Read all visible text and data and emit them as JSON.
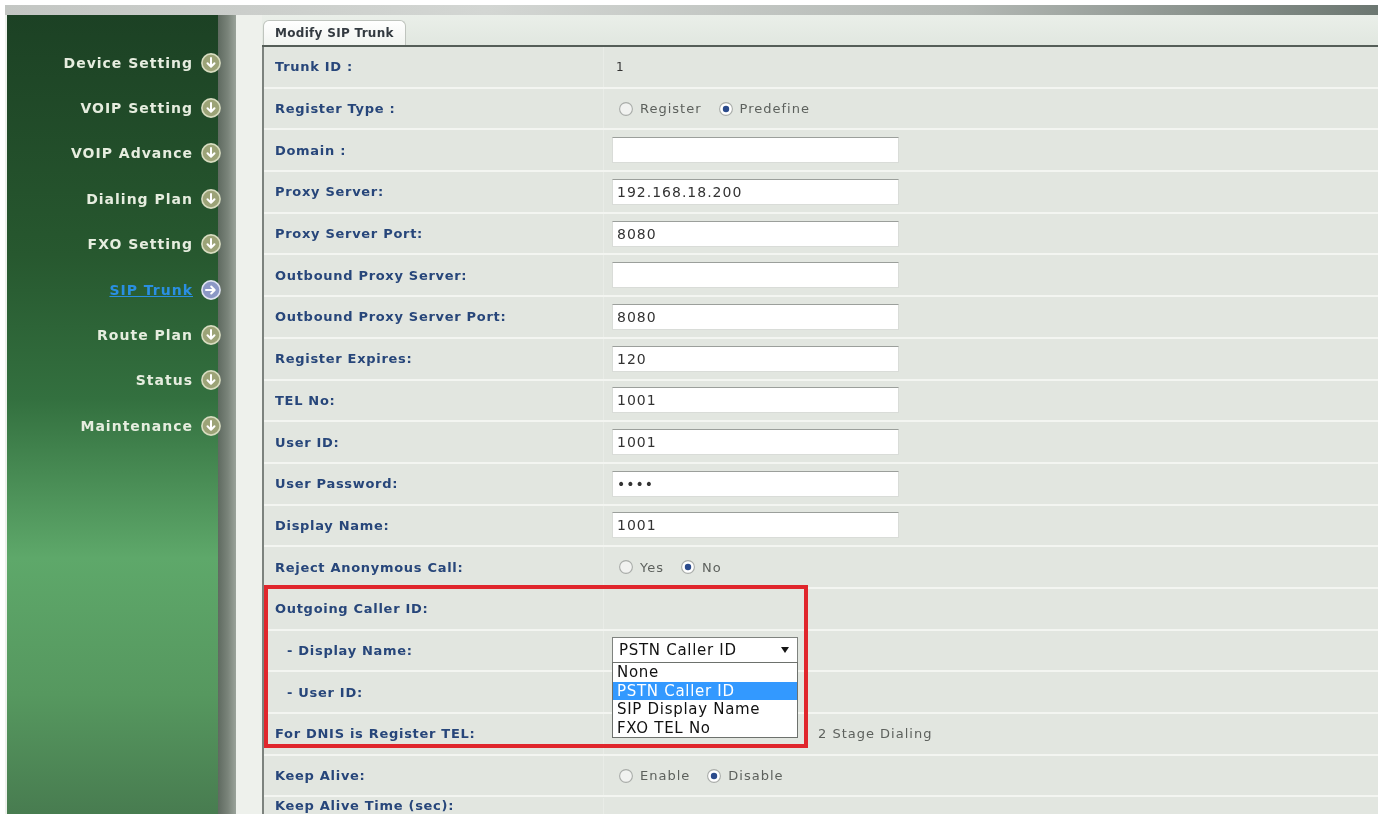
{
  "sidebar": {
    "items": [
      {
        "label": "Device Setting",
        "selected": false
      },
      {
        "label": "VOIP Setting",
        "selected": false
      },
      {
        "label": "VOIP Advance",
        "selected": false
      },
      {
        "label": "Dialing Plan",
        "selected": false
      },
      {
        "label": "FXO Setting",
        "selected": false
      },
      {
        "label": "SIP Trunk",
        "selected": true
      },
      {
        "label": "Route Plan",
        "selected": false
      },
      {
        "label": "Status",
        "selected": false
      },
      {
        "label": "Maintenance",
        "selected": false
      }
    ]
  },
  "tabs": [
    {
      "label": "Modify SIP Trunk",
      "selected": true
    }
  ],
  "form": {
    "rows": [
      {
        "kind": "text",
        "label": "Trunk ID :",
        "value": "1",
        "highlighted": false
      },
      {
        "kind": "radio",
        "label": "Register Type :",
        "options": [
          {
            "label": "Register",
            "selected": false
          },
          {
            "label": "Predefine",
            "selected": true
          }
        ],
        "highlighted": false
      },
      {
        "kind": "input",
        "label": "Domain :",
        "highlighted": false
      },
      {
        "kind": "input",
        "label": "Proxy Server:",
        "value": "192.168.18.200",
        "highlighted": false
      },
      {
        "kind": "input",
        "label": "Proxy Server Port:",
        "value": "8080",
        "highlighted": false
      },
      {
        "kind": "input",
        "label": "Outbound Proxy Server:",
        "highlighted": false
      },
      {
        "kind": "input",
        "label": "Outbound Proxy Server Port:",
        "value": "8080",
        "highlighted": false
      },
      {
        "kind": "input",
        "label": "Register Expires:",
        "value": "120",
        "highlighted": false
      },
      {
        "kind": "input",
        "label": "TEL No:",
        "value": "1001",
        "highlighted": false
      },
      {
        "kind": "input",
        "label": "User ID:",
        "value": "1001",
        "highlighted": false
      },
      {
        "kind": "input",
        "label": "User Password:",
        "value": "••••",
        "highlighted": false
      },
      {
        "kind": "input",
        "label": "Display Name:",
        "value": "1001",
        "highlighted": false
      },
      {
        "kind": "radio",
        "label": "Reject Anonymous Call:",
        "options": [
          {
            "label": "Yes",
            "selected": false
          },
          {
            "label": "No",
            "selected": true
          }
        ],
        "highlighted": false
      },
      {
        "kind": "group",
        "label": "Outgoing Caller ID:",
        "highlighted": true,
        "children": [
          {
            "kind": "select",
            "label": "- Display Name:",
            "value": "PSTN Caller ID",
            "expanded": true,
            "options": [
              {
                "label": "None",
                "selected": false
              },
              {
                "label": "PSTN Caller ID",
                "selected": true
              },
              {
                "label": "SIP Display Name",
                "selected": false
              },
              {
                "label": "FXO TEL No",
                "selected": false
              }
            ],
            "highlighted": true
          },
          {
            "kind": "label",
            "label": "- User ID:",
            "highlighted": true
          }
        ]
      },
      {
        "kind": "covered",
        "label": "For DNIS is Register TEL:",
        "value": "2 Stage Dialing",
        "highlighted": true
      },
      {
        "kind": "radio",
        "label": "Keep Alive:",
        "options": [
          {
            "label": "Enable",
            "selected": false
          },
          {
            "label": "Disable",
            "selected": true
          }
        ],
        "highlighted": false
      },
      {
        "kind": "label",
        "label": "Keep Alive Time (sec):",
        "highlighted": false
      }
    ]
  }
}
